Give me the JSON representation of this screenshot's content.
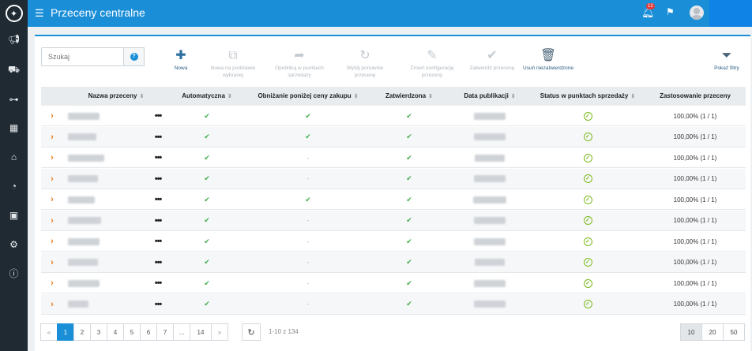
{
  "app": {
    "title": "Przeceny centralne",
    "notifications_count": "12"
  },
  "sidebar": {
    "icons": [
      "megaphone-icon",
      "truck-icon",
      "sitemap-icon",
      "barcode-icon",
      "shop-icon",
      "gauge-icon",
      "cash-icon",
      "cogs-icon",
      "info-icon"
    ]
  },
  "search": {
    "placeholder": "Szukaj",
    "value": ""
  },
  "toolbar": {
    "new": "Nowa",
    "new_based": "Nowa na podstawie wybranej",
    "publish": "Opublikuj w punktach sprzedaży",
    "resend": "Wyślij ponownie przecenę",
    "change_config": "Zmień konfigurację przeceny",
    "approve": "Zatwierdź przecenę",
    "delete_unapproved": "Usuń niezatwierdzone",
    "show_filters": "Pokaż filtry"
  },
  "table": {
    "columns": [
      "Nazwa przeceny",
      "Automatyczna",
      "Obniżanie poniżej ceny zakupu",
      "Zatwierdzona",
      "Data publikacji",
      "Status w punktach sprzedaży",
      "Zastosowanie przeceny"
    ],
    "dots": "•••",
    "rows": [
      {
        "below_purchase": true,
        "usage": "100,00% (1 / 1)"
      },
      {
        "below_purchase": true,
        "usage": "100,00% (1 / 1)"
      },
      {
        "below_purchase": false,
        "usage": "100,00% (1 / 1)"
      },
      {
        "below_purchase": false,
        "usage": "100,00% (1 / 1)"
      },
      {
        "below_purchase": true,
        "usage": "100,00% (1 / 1)"
      },
      {
        "below_purchase": false,
        "usage": "100,00% (1 / 1)"
      },
      {
        "below_purchase": false,
        "usage": "100,00% (1 / 1)"
      },
      {
        "below_purchase": false,
        "usage": "100,00% (1 / 1)"
      },
      {
        "below_purchase": false,
        "usage": "100,00% (1 / 1)"
      },
      {
        "below_purchase": false,
        "usage": "100,00% (1 / 1)"
      }
    ]
  },
  "pagination": {
    "prev": "«",
    "pages": [
      "1",
      "2",
      "3",
      "4",
      "5",
      "6",
      "7",
      "...",
      "14"
    ],
    "next": "»",
    "current": "1",
    "range": "1-10 z 134",
    "page_sizes": [
      "10",
      "20",
      "50"
    ],
    "page_size_selected": "10"
  },
  "colors": {
    "accent": "#1a8fd8",
    "sidebar": "#1f2a33",
    "check": "#3fae49",
    "expand": "#e87a1e"
  }
}
